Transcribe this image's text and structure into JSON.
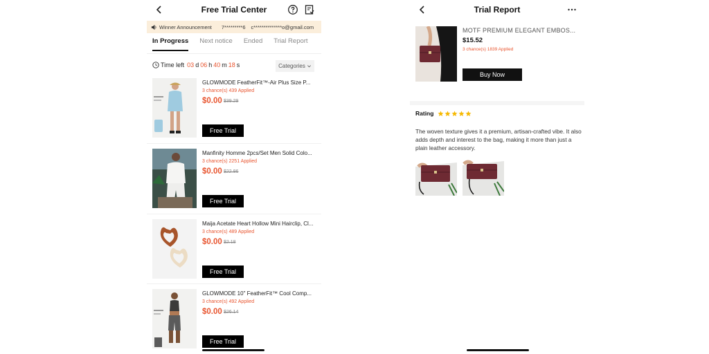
{
  "left": {
    "title": "Free Trial Center",
    "announcement": {
      "label": "Winner Announcement",
      "user_id": "7*********6",
      "email": "c**************o@gmail.com"
    },
    "tabs": [
      {
        "label": "In Progress",
        "active": true
      },
      {
        "label": "Next notice",
        "active": false
      },
      {
        "label": "Ended",
        "active": false
      },
      {
        "label": "Trial Report",
        "active": false
      }
    ],
    "timer": {
      "label": "Time left",
      "days": "03",
      "days_unit": "d",
      "hours": "06",
      "hours_unit": "h",
      "minutes": "40",
      "minutes_unit": "m",
      "seconds": "18",
      "seconds_unit": "s"
    },
    "categories_label": "Categories",
    "products": [
      {
        "name": "GLOWMODE FeatherFit™-Air Plus Size P...",
        "chances": "3 chance(s) 439 Applied",
        "price": "$0.00",
        "original_price": "$39.29",
        "button": "Free Trial"
      },
      {
        "name": "Manfinity Homme 2pcs/Set Men Solid Colo...",
        "chances": "3 chance(s) 2251 Applied",
        "price": "$0.00",
        "original_price": "$22.86",
        "button": "Free Trial"
      },
      {
        "name": "Maija Acetate Heart Hollow Mini Hairclip, Cl...",
        "chances": "3 chance(s) 489 Applied",
        "price": "$0.00",
        "original_price": "$2.18",
        "button": "Free Trial"
      },
      {
        "name": "GLOWMODE 10\" FeatherFit™ Cool Comp...",
        "chances": "3 chance(s) 492 Applied",
        "price": "$0.00",
        "original_price": "$26.14",
        "button": "Free Trial"
      }
    ]
  },
  "right": {
    "title": "Trial Report",
    "product": {
      "name": "MOTF PREMIUM ELEGANT EMBOS...",
      "price": "$15.52",
      "chances": "3 chance(s) 1839 Applied",
      "button": "Buy Now"
    },
    "rating_label": "Rating",
    "rating_stars": 5,
    "review_text": "The woven texture gives it a premium, artisan-crafted vibe. It also adds depth and interest to the bag, making it more than just a plain leather accessory."
  },
  "colors": {
    "accent": "#e8542e",
    "star": "#f5b800",
    "announcement_bg": "#fbeedb",
    "button_bg": "#000000"
  },
  "icons": [
    "chevron-left-icon",
    "help-circle-icon",
    "report-icon",
    "speaker-icon",
    "clock-icon",
    "chevron-down-icon",
    "more-icon",
    "star-icon"
  ]
}
